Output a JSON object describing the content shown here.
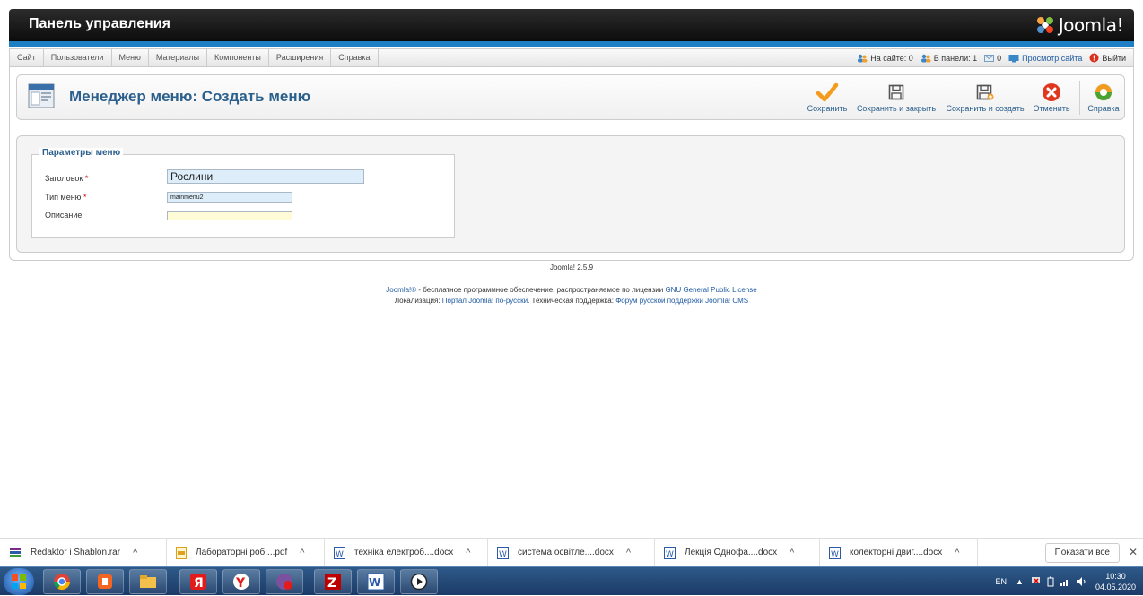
{
  "header": {
    "title": "Панель управления",
    "logo_text": "Joomla!"
  },
  "menubar": {
    "items": [
      "Сайт",
      "Пользователи",
      "Меню",
      "Материалы",
      "Компоненты",
      "Расширения",
      "Справка"
    ],
    "status": {
      "on_site": "На сайте: 0",
      "in_panel": "В панели: 1",
      "messages": "0",
      "view_site": "Просмотр сайта",
      "logout": "Выйти"
    }
  },
  "toolbar": {
    "title": "Менеджер меню: Создать меню",
    "buttons": {
      "save": "Сохранить",
      "save_close": "Сохранить и закрыть",
      "save_new": "Сохранить и создать",
      "cancel": "Отменить",
      "help": "Справка"
    }
  },
  "form": {
    "legend": "Параметры меню",
    "title_label": "Заголовок",
    "title_value": "Рослини",
    "type_label": "Тип меню",
    "type_value": "mainmenu2",
    "desc_label": "Описание",
    "desc_value": "",
    "required_mark": "*"
  },
  "footer": {
    "version": "Joomla! 2.5.9",
    "line1": {
      "brand": "Joomla!®",
      "text": " - бесплатное программное обеспечение, распространяемое по лицензии ",
      "license": "GNU General Public License"
    },
    "line2": {
      "loc_label": "Локализация: ",
      "loc_link": "Портал Joomla! по-русски",
      "support_label": ". Техническая поддержка: ",
      "support_link": "Форум русской поддержки Joomla! CMS"
    }
  },
  "downloads": {
    "items": [
      "Redaktor i Shablon.rar",
      "Лабораторні роб....pdf",
      "техніка електроб....docx",
      "система освітле....docx",
      "Лекція  Однофа....docx",
      "колекторні двиг....docx"
    ],
    "show_all": "Показати все"
  },
  "taskbar": {
    "lang": "EN",
    "time": "10:30",
    "date": "04.05.2020"
  },
  "colors": {
    "accent": "#2b5f8c",
    "header_bar": "#1f7fc4"
  }
}
